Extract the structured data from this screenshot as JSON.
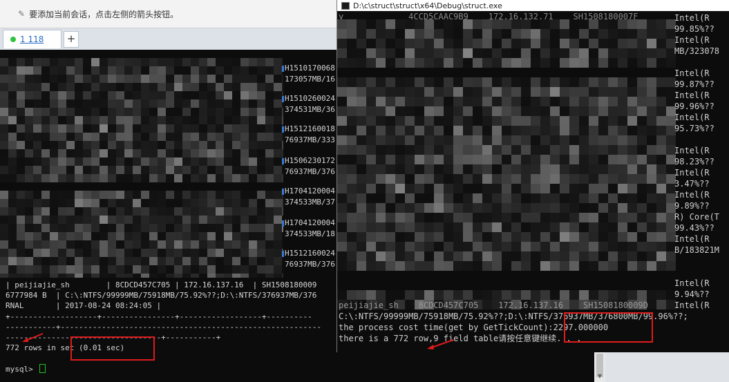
{
  "notice_bar": {
    "text": "要添加当前会话，点击左侧的箭头按钮。"
  },
  "tabs": [
    {
      "label": "1 118",
      "status_color": "#2ec43f"
    }
  ],
  "new_tab": {
    "label": "+"
  },
  "left_terminal": {
    "right_edge_lines": [
      "H1510170068",
      "173057MB/16",
      "H1510260024",
      "374531MB/36",
      "H1512160018",
      "76937MB/333",
      "H1506230172",
      "76937MB/376",
      "H1704120004",
      "374533MB/37",
      "H1704120004",
      "374533MB/18",
      "H1512160024",
      "76937MB/376"
    ],
    "lines": [
      "| peijiajie_sh        | 8CDCD457C705 | 172.16.137.16  | SH1508180009",
      "6777984 B  | C:\\:NTFS/99999MB/75918MB/75.92%??;D:\\:NTFS/376937MB/376",
      "RNAL       | 2017-08-24 08:24:05 |",
      "+-------------------+----------------+------------------+----------",
      "-----------+---------------------------------------------------------",
      "----------------------------------+-----------+",
      "772 rows in set (0.01 sec)",
      "",
      "mysql> "
    ]
  },
  "right_window": {
    "title": "D:\\c\\struct\\struct\\x64\\Debug\\struct.exe",
    "top_partial_line": "y             4CCD5CAAC9B9    172.16.132.71    SH1508180007F",
    "side_lines": [
      "Intel(R",
      "99.85%??",
      "Intel(R",
      "MB/323078",
      "Intel(R",
      "99.87%??",
      "Intel(R",
      "99.96%??",
      "Intel(R",
      "95.73%??",
      "Intel(R",
      "98.23%??",
      "Intel(R",
      "3.47%??",
      "Intel(R",
      "9.89%??",
      "R) Core(T",
      "99.43%??",
      "Intel(R",
      "B/183821M",
      "Intel(R",
      "9.94%??",
      "Intel(R"
    ],
    "partial_row": "peijiajie_sh    8CDCD457C705    172.16.137.16    SH1508180009D",
    "bottom_lines": [
      "C:\\:NTFS/99999MB/75918MB/75.92%??;D:\\:NTFS/376937MB/376800MB/99.96%??;",
      "the process cost time(get by GetTickCount):2297.000000",
      "there is a 772 row,9 field table请按任意键继续. . ."
    ]
  },
  "colors": {
    "annotation_red": "#e01b1b",
    "prompt_cursor": "#22c322",
    "terminal_bg": "#0c0c0c"
  }
}
